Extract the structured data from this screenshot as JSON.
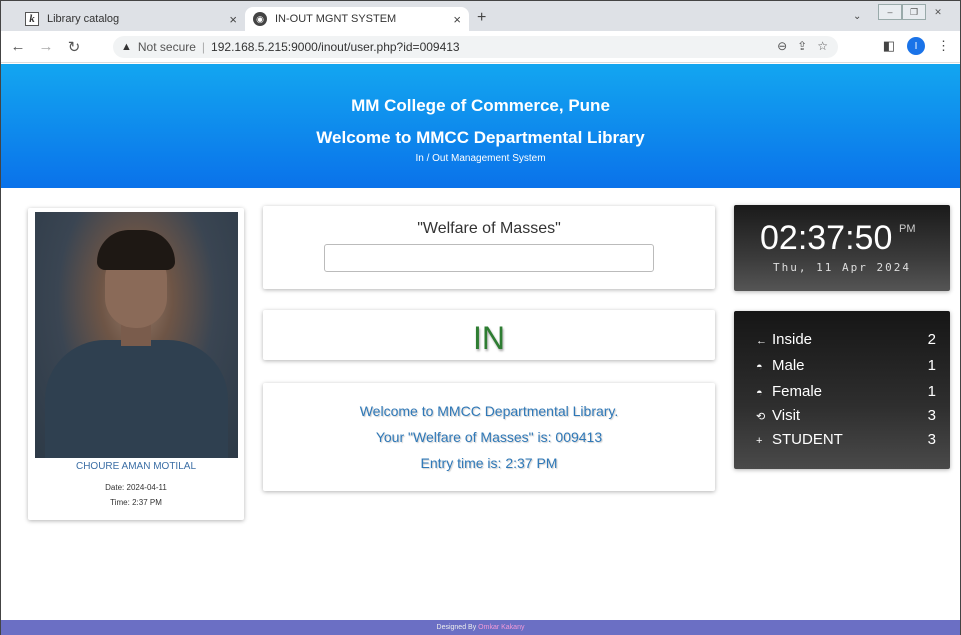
{
  "browser": {
    "tabs": [
      {
        "label": "Library catalog",
        "icon": "k-icon"
      },
      {
        "label": "IN-OUT MGNT SYSTEM",
        "icon": "globe-icon"
      }
    ],
    "new_tab": "+",
    "not_secure": "Not secure",
    "url": "192.168.5.215:9000/inout/user.php?id=009413",
    "profile_initial": "I"
  },
  "banner": {
    "college": "MM College of Commerce, Pune",
    "welcome": "Welcome to MMCC Departmental Library",
    "system": "In / Out Management System"
  },
  "profile": {
    "name": "CHOURE AMAN MOTILAL",
    "date": "Date: 2024-04-11",
    "time": "Time: 2:37 PM"
  },
  "motto": "\"Welfare of Masses\"",
  "status": "IN",
  "message": {
    "line1": "Welcome to MMCC Departmental Library.",
    "line2": "Your \"Welfare of Masses\" is: 009413",
    "line3": "Entry time is: 2:37 PM"
  },
  "clock": {
    "time": "02:37:50",
    "ampm": "PM",
    "date": "Thu, 11 Apr 2024"
  },
  "stats": [
    {
      "icon": "←",
      "label": "Inside",
      "value": "2"
    },
    {
      "icon": "◓",
      "label": "Male",
      "value": "1"
    },
    {
      "icon": "◓",
      "label": "Female",
      "value": "1"
    },
    {
      "icon": "⟲",
      "label": "Visit",
      "value": "3"
    },
    {
      "icon": "+",
      "label": "STUDENT",
      "value": "3"
    }
  ],
  "footer": {
    "prefix": "Designed By",
    "author": "Omkar Kakany"
  }
}
